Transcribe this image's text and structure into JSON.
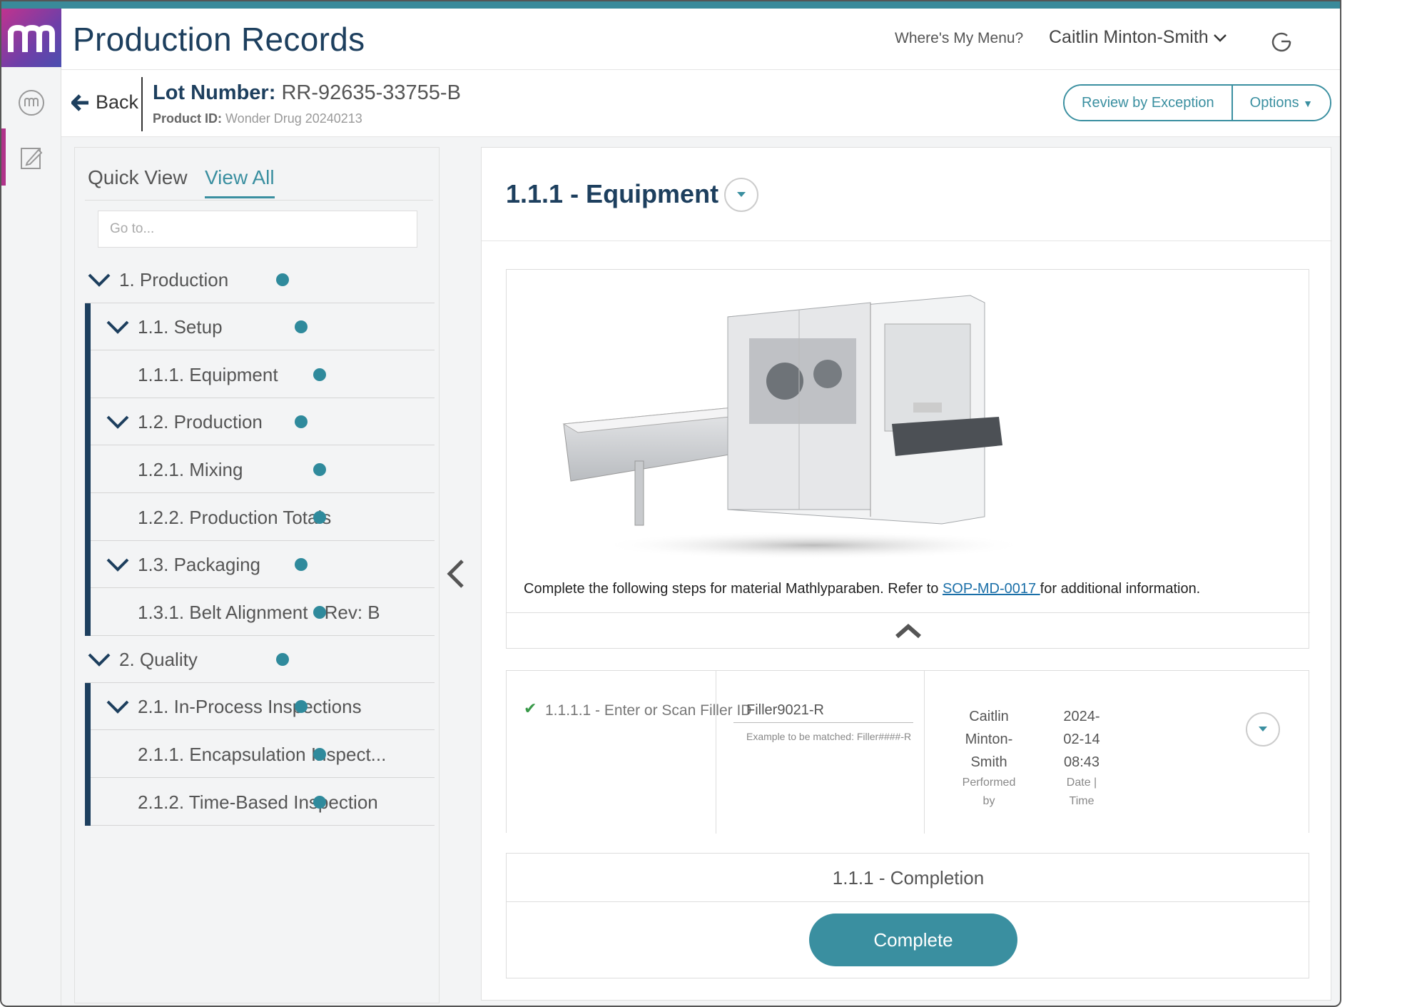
{
  "app": {
    "title": "Production Records"
  },
  "header": {
    "menu_link": "Where's My Menu?",
    "user_name": "Caitlin Minton-Smith"
  },
  "subheader": {
    "back_label": "Back",
    "lot_label": "Lot Number:",
    "lot_value": "RR-92635-33755-B",
    "product_label": "Product ID:",
    "product_value": "Wonder Drug 20240213",
    "review_button": "Review by Exception",
    "options_button": "Options"
  },
  "nav": {
    "tabs": [
      {
        "label": "Quick View",
        "active": false
      },
      {
        "label": "View All",
        "active": true
      }
    ],
    "goto_placeholder": "Go to...",
    "items": [
      {
        "label": "1.  Production",
        "level": 0,
        "expandable": true
      },
      {
        "label": "1.1.  Setup",
        "level": 1,
        "expandable": true
      },
      {
        "label": "1.1.1.  Equipment",
        "level": 2,
        "expandable": false
      },
      {
        "label": "1.2.  Production",
        "level": 1,
        "expandable": true
      },
      {
        "label": "1.2.1.  Mixing",
        "level": 2,
        "expandable": false
      },
      {
        "label": "1.2.2.  Production Totals",
        "level": 2,
        "expandable": false
      },
      {
        "label": "1.3.  Packaging",
        "level": 1,
        "expandable": true
      },
      {
        "label": "1.3.1.  Belt Alignment - Rev: B",
        "level": 2,
        "expandable": false
      },
      {
        "label": "2.  Quality",
        "level": 0,
        "expandable": true
      },
      {
        "label": "2.1.  In-Process Inspections",
        "level": 1,
        "expandable": true
      },
      {
        "label": "2.1.1.  Encapsulation Inspect...",
        "level": 2,
        "expandable": false
      },
      {
        "label": "2.1.2.  Time-Based Inspection",
        "level": 2,
        "expandable": false
      }
    ]
  },
  "main": {
    "title": "1.1.1 - Equipment",
    "instruction_prefix": "Complete the following steps for material Mathlyparaben. Refer to ",
    "instruction_link": "SOP-MD-0017 ",
    "instruction_suffix": "for additional information.",
    "step": {
      "label": "1.1.1.1 - Enter or Scan Filler ID",
      "value": "Filler9021-R",
      "hint": "Example to be matched: Filler####-R",
      "performer_lines": [
        "Caitlin",
        "Minton-",
        "Smith"
      ],
      "performer_caption": "Performed by",
      "date_lines": [
        "2024-",
        "02-14",
        "08:43"
      ],
      "date_caption": "Date | Time"
    },
    "completion_label": "1.1.1 - Completion",
    "complete_button": "Complete"
  },
  "colors": {
    "accent": "#3a8fa0",
    "navy": "#1d3f5e",
    "status_dot": "#2f8a9c"
  }
}
